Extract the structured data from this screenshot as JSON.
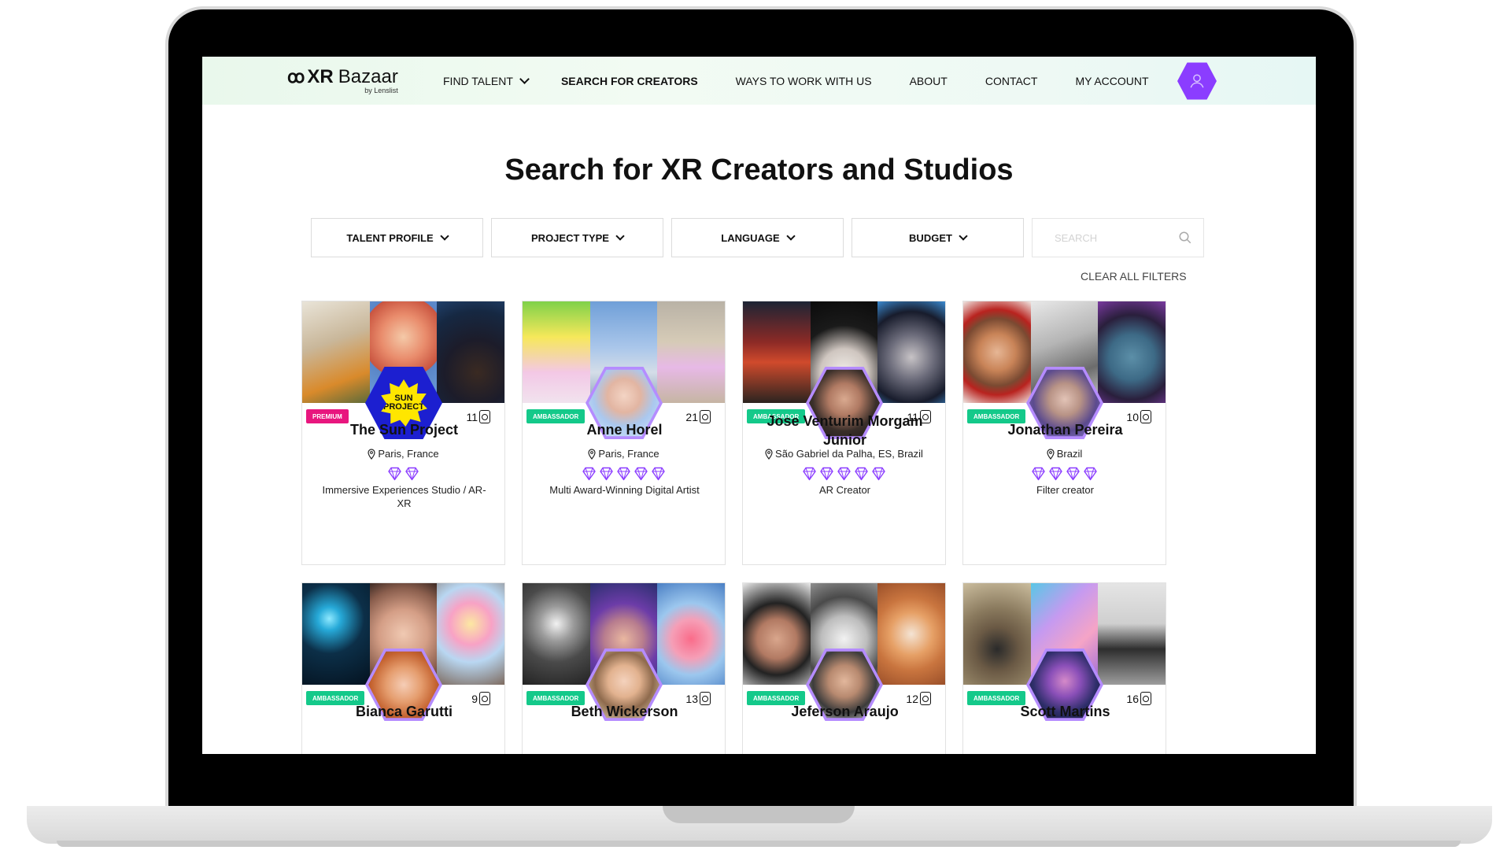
{
  "brand": {
    "mark": "ꝏ",
    "xr": "XR",
    "name": "Bazaar",
    "sub": "by Lenslist"
  },
  "nav": [
    {
      "label": "FIND TALENT",
      "has_dropdown": true,
      "active": false
    },
    {
      "label": "SEARCH FOR CREATORS",
      "active": true
    },
    {
      "label": "WAYS TO WORK WITH US",
      "active": false
    },
    {
      "label": "ABOUT",
      "active": false
    },
    {
      "label": "CONTACT",
      "active": false
    },
    {
      "label": "MY ACCOUNT",
      "active": false
    }
  ],
  "page_title": "Search for XR Creators and Studios",
  "filters": [
    {
      "label": "TALENT PROFILE"
    },
    {
      "label": "PROJECT TYPE"
    },
    {
      "label": "LANGUAGE"
    },
    {
      "label": "BUDGET"
    }
  ],
  "search": {
    "placeholder": "SEARCH",
    "value": ""
  },
  "clear_filters": "CLEAR ALL FILTERS",
  "colors": {
    "accent_purple": "#8b3dff",
    "premium_pink": "#e8167e",
    "ambassador_green": "#14c98a"
  },
  "cards": [
    {
      "name": "The Sun Project",
      "badge": "PREMIUM",
      "count": "11",
      "location": "Paris, France",
      "gems": 2,
      "description": "Immersive Experiences Studio / AR-XR",
      "sun_text": "SUN PROJECT"
    },
    {
      "name": "Anne Horel",
      "badge": "AMBASSADOR",
      "count": "21",
      "location": "Paris, France",
      "gems": 5,
      "description": "Multi Award-Winning Digital Artist"
    },
    {
      "name": "Jose Venturim Morgam Junior",
      "badge": "AMBASSADOR",
      "count": "11",
      "location": "São Gabriel da Palha, ES, Brazil",
      "gems": 5,
      "description": "AR Creator"
    },
    {
      "name": "Jonathan Pereira",
      "badge": "AMBASSADOR",
      "count": "10",
      "location": "Brazil",
      "gems": 4,
      "description": "Filter creator"
    },
    {
      "name": "Bianca Garutti",
      "badge": "AMBASSADOR",
      "count": "9"
    },
    {
      "name": "Beth Wickerson",
      "badge": "AMBASSADOR",
      "count": "13"
    },
    {
      "name": "Jeferson Araujo",
      "badge": "AMBASSADOR",
      "count": "12"
    },
    {
      "name": "Scott Martins",
      "badge": "AMBASSADOR",
      "count": "16"
    }
  ]
}
